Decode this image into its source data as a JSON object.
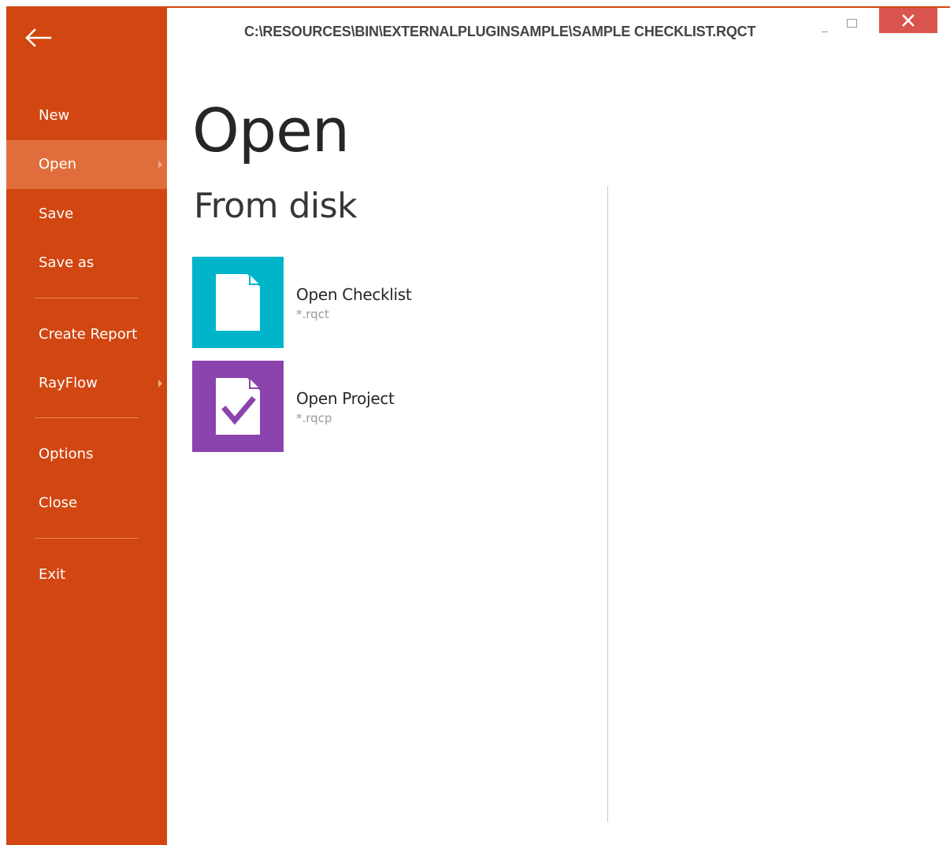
{
  "window": {
    "title_path": "C:\\RESOURCES\\BIN\\EXTERNALPLUGINSAMPLE\\SAMPLE CHECKLIST.RQCT",
    "close_glyph": "✕"
  },
  "colors": {
    "sidebar": "#d24611",
    "sidebar_active": "#e06e3c",
    "checklist_tile": "#00b4ca",
    "project_tile": "#8b44ad",
    "close_button": "#d9534f"
  },
  "sidebar": {
    "back_icon": "back-arrow-icon",
    "items": [
      {
        "label": "New"
      },
      {
        "label": "Open"
      },
      {
        "label": "Save"
      },
      {
        "label": "Save as"
      },
      {
        "label": "Create Report"
      },
      {
        "label": "RayFlow"
      },
      {
        "label": "Options"
      },
      {
        "label": "Close"
      },
      {
        "label": "Exit"
      }
    ],
    "active_item": "Open"
  },
  "main": {
    "title": "Open",
    "section_title": "From disk",
    "options": [
      {
        "label": "Open Checklist",
        "extension": "*.rqct",
        "icon": "document-icon"
      },
      {
        "label": "Open Project",
        "extension": "*.rqcp",
        "icon": "document-check-icon"
      }
    ]
  }
}
